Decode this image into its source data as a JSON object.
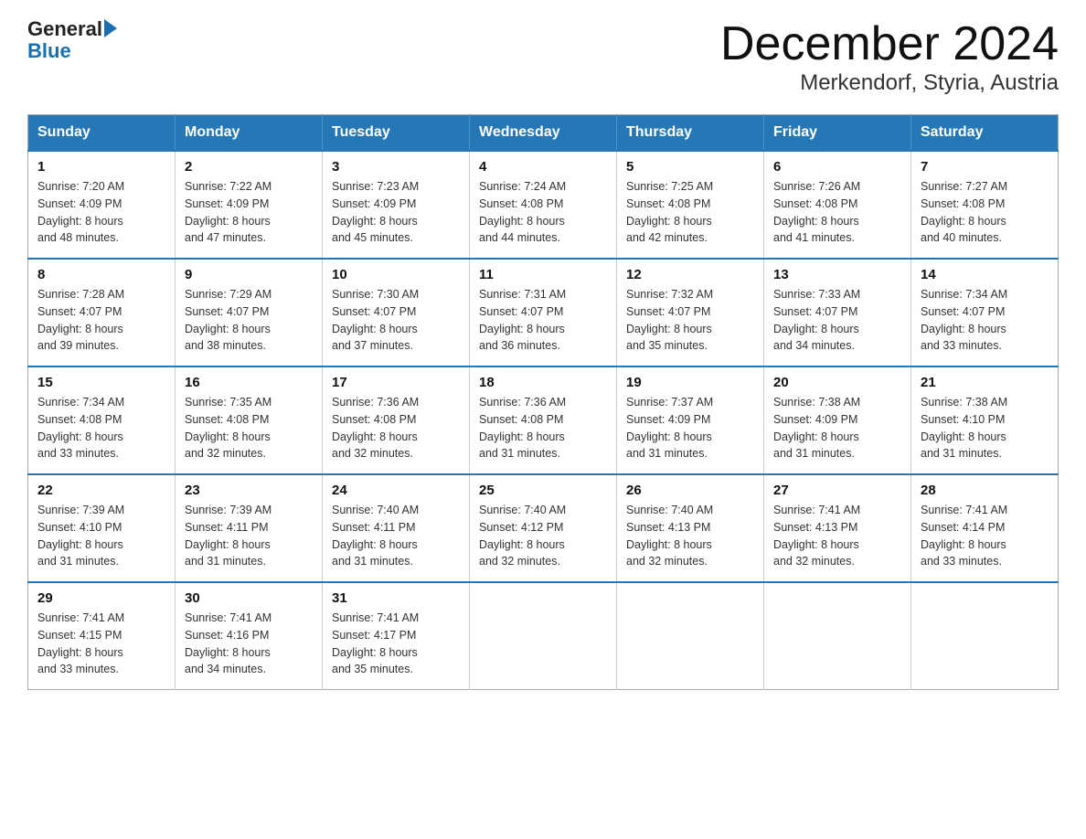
{
  "header": {
    "logo": {
      "general": "General",
      "blue": "Blue",
      "arrow": "▶"
    },
    "month": "December 2024",
    "location": "Merkendorf, Styria, Austria"
  },
  "weekdays": [
    "Sunday",
    "Monday",
    "Tuesday",
    "Wednesday",
    "Thursday",
    "Friday",
    "Saturday"
  ],
  "weeks": [
    [
      {
        "day": "1",
        "sunrise": "7:20 AM",
        "sunset": "4:09 PM",
        "daylight": "8 hours and 48 minutes."
      },
      {
        "day": "2",
        "sunrise": "7:22 AM",
        "sunset": "4:09 PM",
        "daylight": "8 hours and 47 minutes."
      },
      {
        "day": "3",
        "sunrise": "7:23 AM",
        "sunset": "4:09 PM",
        "daylight": "8 hours and 45 minutes."
      },
      {
        "day": "4",
        "sunrise": "7:24 AM",
        "sunset": "4:08 PM",
        "daylight": "8 hours and 44 minutes."
      },
      {
        "day": "5",
        "sunrise": "7:25 AM",
        "sunset": "4:08 PM",
        "daylight": "8 hours and 42 minutes."
      },
      {
        "day": "6",
        "sunrise": "7:26 AM",
        "sunset": "4:08 PM",
        "daylight": "8 hours and 41 minutes."
      },
      {
        "day": "7",
        "sunrise": "7:27 AM",
        "sunset": "4:08 PM",
        "daylight": "8 hours and 40 minutes."
      }
    ],
    [
      {
        "day": "8",
        "sunrise": "7:28 AM",
        "sunset": "4:07 PM",
        "daylight": "8 hours and 39 minutes."
      },
      {
        "day": "9",
        "sunrise": "7:29 AM",
        "sunset": "4:07 PM",
        "daylight": "8 hours and 38 minutes."
      },
      {
        "day": "10",
        "sunrise": "7:30 AM",
        "sunset": "4:07 PM",
        "daylight": "8 hours and 37 minutes."
      },
      {
        "day": "11",
        "sunrise": "7:31 AM",
        "sunset": "4:07 PM",
        "daylight": "8 hours and 36 minutes."
      },
      {
        "day": "12",
        "sunrise": "7:32 AM",
        "sunset": "4:07 PM",
        "daylight": "8 hours and 35 minutes."
      },
      {
        "day": "13",
        "sunrise": "7:33 AM",
        "sunset": "4:07 PM",
        "daylight": "8 hours and 34 minutes."
      },
      {
        "day": "14",
        "sunrise": "7:34 AM",
        "sunset": "4:07 PM",
        "daylight": "8 hours and 33 minutes."
      }
    ],
    [
      {
        "day": "15",
        "sunrise": "7:34 AM",
        "sunset": "4:08 PM",
        "daylight": "8 hours and 33 minutes."
      },
      {
        "day": "16",
        "sunrise": "7:35 AM",
        "sunset": "4:08 PM",
        "daylight": "8 hours and 32 minutes."
      },
      {
        "day": "17",
        "sunrise": "7:36 AM",
        "sunset": "4:08 PM",
        "daylight": "8 hours and 32 minutes."
      },
      {
        "day": "18",
        "sunrise": "7:36 AM",
        "sunset": "4:08 PM",
        "daylight": "8 hours and 31 minutes."
      },
      {
        "day": "19",
        "sunrise": "7:37 AM",
        "sunset": "4:09 PM",
        "daylight": "8 hours and 31 minutes."
      },
      {
        "day": "20",
        "sunrise": "7:38 AM",
        "sunset": "4:09 PM",
        "daylight": "8 hours and 31 minutes."
      },
      {
        "day": "21",
        "sunrise": "7:38 AM",
        "sunset": "4:10 PM",
        "daylight": "8 hours and 31 minutes."
      }
    ],
    [
      {
        "day": "22",
        "sunrise": "7:39 AM",
        "sunset": "4:10 PM",
        "daylight": "8 hours and 31 minutes."
      },
      {
        "day": "23",
        "sunrise": "7:39 AM",
        "sunset": "4:11 PM",
        "daylight": "8 hours and 31 minutes."
      },
      {
        "day": "24",
        "sunrise": "7:40 AM",
        "sunset": "4:11 PM",
        "daylight": "8 hours and 31 minutes."
      },
      {
        "day": "25",
        "sunrise": "7:40 AM",
        "sunset": "4:12 PM",
        "daylight": "8 hours and 32 minutes."
      },
      {
        "day": "26",
        "sunrise": "7:40 AM",
        "sunset": "4:13 PM",
        "daylight": "8 hours and 32 minutes."
      },
      {
        "day": "27",
        "sunrise": "7:41 AM",
        "sunset": "4:13 PM",
        "daylight": "8 hours and 32 minutes."
      },
      {
        "day": "28",
        "sunrise": "7:41 AM",
        "sunset": "4:14 PM",
        "daylight": "8 hours and 33 minutes."
      }
    ],
    [
      {
        "day": "29",
        "sunrise": "7:41 AM",
        "sunset": "4:15 PM",
        "daylight": "8 hours and 33 minutes."
      },
      {
        "day": "30",
        "sunrise": "7:41 AM",
        "sunset": "4:16 PM",
        "daylight": "8 hours and 34 minutes."
      },
      {
        "day": "31",
        "sunrise": "7:41 AM",
        "sunset": "4:17 PM",
        "daylight": "8 hours and 35 minutes."
      },
      null,
      null,
      null,
      null
    ]
  ],
  "labels": {
    "sunrise": "Sunrise:",
    "sunset": "Sunset:",
    "daylight": "Daylight:"
  }
}
